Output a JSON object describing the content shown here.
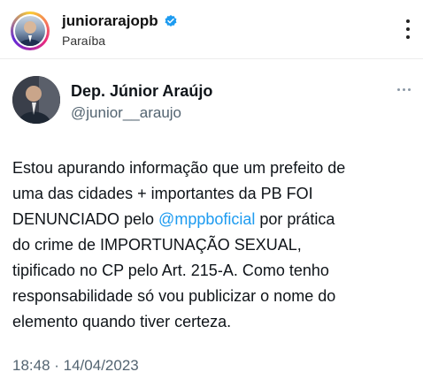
{
  "post_header": {
    "username": "juniorarajopb",
    "location": "Paraíba",
    "verified_icon": "verified-badge-icon",
    "menu_icon": "more-vertical-icon"
  },
  "tweet": {
    "display_name": "Dep. Júnior Araújo",
    "handle": "@junior__araujo",
    "menu_icon": "more-horizontal-icon",
    "text_lines": [
      "Estou apurando informação que um prefeito de",
      "uma das cidades + importantes da PB FOI",
      "DENUNCIADO pelo ",
      "do crime de IMPORTUNAÇÃO SEXUAL,",
      "tipificado no CP pelo Art. 215-A. Como tenho",
      "responsabilidade só vou publicizar o nome do",
      "elemento quando tiver certeza."
    ],
    "mention": "@mppboficial",
    "line3_after_mention": " por prática",
    "timestamp": "18:48 · 14/04/2023"
  },
  "colors": {
    "mention": "#1d9bf0",
    "secondary_text": "#536471",
    "verified": "#1d9bf0"
  }
}
